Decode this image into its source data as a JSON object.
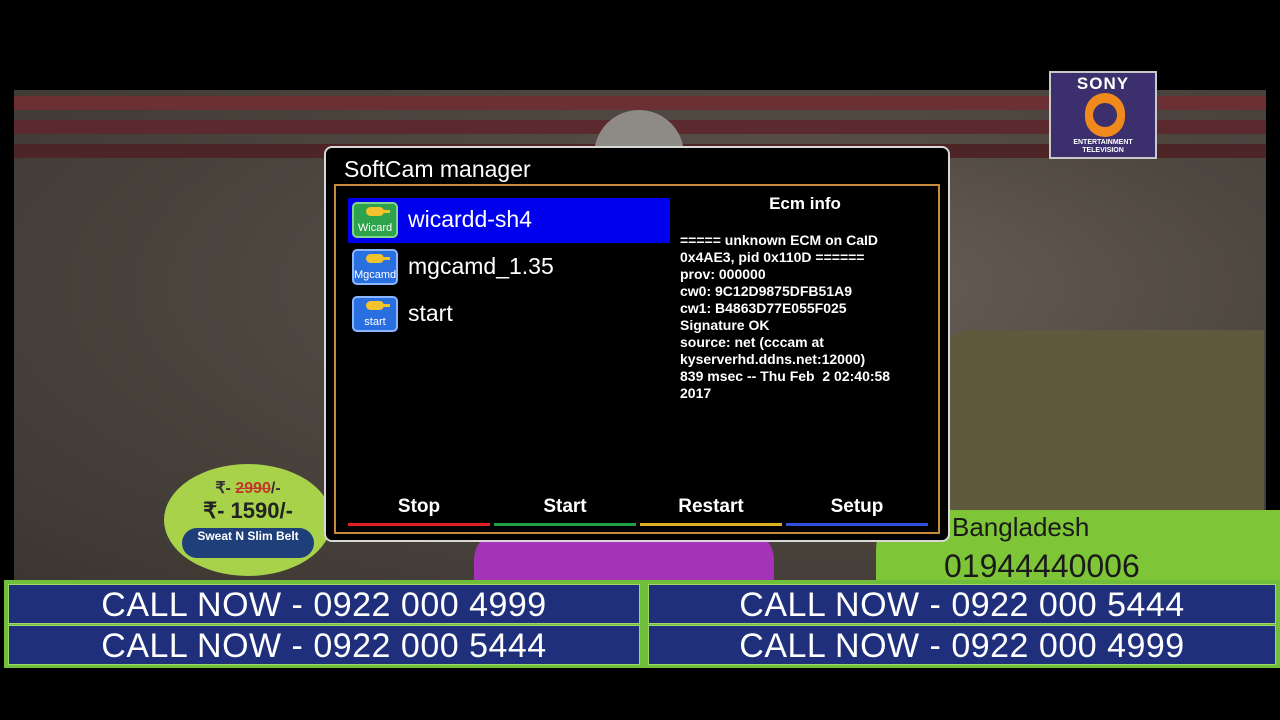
{
  "dialog": {
    "title": "SoftCam manager",
    "cams": [
      {
        "icon_label": "Wicard",
        "name": "wicardd-sh4",
        "icon": "key-icon",
        "selected": true
      },
      {
        "icon_label": "Mgcamd",
        "name": "mgcamd_1.35",
        "icon": "key-icon",
        "selected": false
      },
      {
        "icon_label": "start",
        "name": "start",
        "icon": "key-icon",
        "selected": false
      }
    ],
    "ecm": {
      "heading": "Ecm info",
      "text": "===== unknown ECM on CaID\n0x4AE3, pid 0x110D ======\nprov: 000000\ncw0: 9C12D9875DFB51A9\ncw1: B4863D77E055F025\nSignature OK\nsource: net (cccam at\nkyserverhd.ddns.net:12000)\n839 msec -- Thu Feb  2 02:40:58\n2017"
    },
    "buttons": [
      {
        "label": "Stop",
        "color": "#e02020"
      },
      {
        "label": "Start",
        "color": "#20a040"
      },
      {
        "label": "Restart",
        "color": "#e0b020"
      },
      {
        "label": "Setup",
        "color": "#3050e0"
      }
    ]
  },
  "overlay": {
    "logo": {
      "brand": "SONY",
      "tagline": "ENTERTAINMENT TELEVISION"
    },
    "price": {
      "old_prefix": "₹-",
      "old_value": "2990",
      "old_suffix": "/-",
      "new": "₹- 1590/-",
      "product": "Sweat N Slim Belt"
    },
    "promo": {
      "country": "Bangladesh",
      "phone": "01944440006"
    },
    "call_now": [
      "CALL NOW - 0922 000 4999",
      "CALL NOW - 0922 000 5444",
      "CALL NOW - 0922 000 5444",
      "CALL NOW - 0922 000 4999"
    ]
  }
}
